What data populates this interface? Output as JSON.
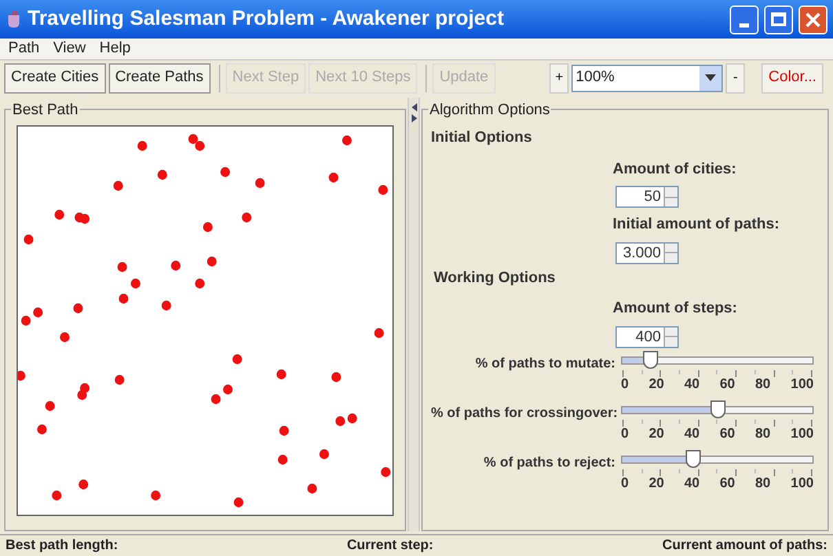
{
  "window": {
    "title": "Travelling Salesman Problem - Awakener project"
  },
  "menu": [
    "Path",
    "View",
    "Help"
  ],
  "toolbar": {
    "buttons": [
      {
        "label": "Create Cities",
        "disabled": false
      },
      {
        "label": "Create Paths",
        "disabled": false
      },
      {
        "label": "Next Step",
        "disabled": true
      },
      {
        "label": "Next 10 Steps",
        "disabled": true
      },
      {
        "label": "Update",
        "disabled": true
      }
    ],
    "zoom_in": "+",
    "zoom": "100%",
    "zoom_out": "-",
    "color_button": "Color..."
  },
  "best_path": {
    "title": "Best Path"
  },
  "algorithm_options": {
    "title": "Algorithm Options",
    "initial_heading": "Initial Options",
    "initial_fields": [
      {
        "label": "Amount of cities:",
        "value": "50"
      },
      {
        "label": "Initial amount of paths:",
        "value": "3.000"
      }
    ],
    "working_heading": "Working Options",
    "steps_field": {
      "label": "Amount of steps:",
      "value": "400"
    },
    "sliders": [
      {
        "label": "% of paths to mutate:",
        "level": 0.15,
        "ticks": [
          "0",
          "20",
          "40",
          "60",
          "80",
          "100"
        ]
      },
      {
        "label": "% of paths for crossingover:",
        "level": 0.51,
        "ticks": [
          "0",
          "20",
          "40",
          "60",
          "80",
          "100"
        ]
      },
      {
        "label": "% of paths to reject:",
        "level": 0.38,
        "ticks": [
          "0",
          "20",
          "40",
          "60",
          "80",
          "100"
        ]
      }
    ]
  },
  "status_bar": [
    "Best path length:",
    "Current step:",
    "Current amount of paths:"
  ]
}
